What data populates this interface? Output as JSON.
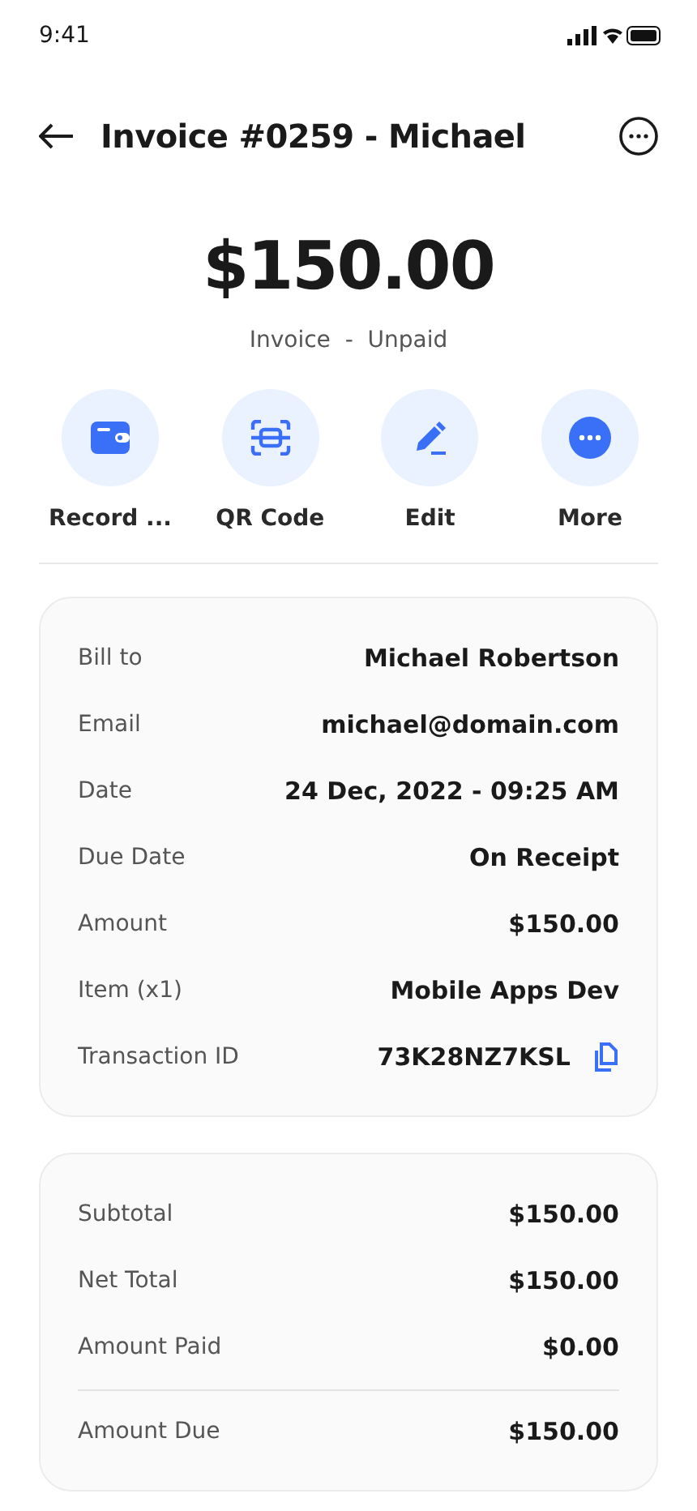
{
  "status_bar": {
    "time": "9:41"
  },
  "header": {
    "title": "Invoice #0259 - Michael"
  },
  "amount": "$150.00",
  "subtitle": "Invoice  -  Unpaid",
  "actions": [
    {
      "kind": "wallet",
      "label": "Record ..."
    },
    {
      "kind": "scan",
      "label": "QR Code"
    },
    {
      "kind": "edit",
      "label": "Edit"
    },
    {
      "kind": "more",
      "label": "More"
    }
  ],
  "details": [
    {
      "label": "Bill to",
      "value": "Michael Robertson",
      "copyable": false
    },
    {
      "label": "Email",
      "value": "michael@domain.com",
      "copyable": false
    },
    {
      "label": "Date",
      "value": "24 Dec, 2022 - 09:25 AM",
      "copyable": false
    },
    {
      "label": "Due Date",
      "value": "On Receipt",
      "copyable": false
    },
    {
      "label": "Amount",
      "value": "$150.00",
      "copyable": false
    },
    {
      "label": "Item (x1)",
      "value": "Mobile Apps Dev",
      "copyable": false
    },
    {
      "label": "Transaction ID",
      "value": "73K28NZ7KSL",
      "copyable": true
    }
  ],
  "summary": [
    {
      "kind": "line",
      "label": "Subtotal",
      "value": "$150.00"
    },
    {
      "kind": "line",
      "label": "Net Total",
      "value": "$150.00"
    },
    {
      "kind": "line",
      "label": "Amount Paid",
      "value": "$0.00"
    },
    {
      "kind": "total",
      "label": "Amount Due",
      "value": "$150.00"
    }
  ]
}
